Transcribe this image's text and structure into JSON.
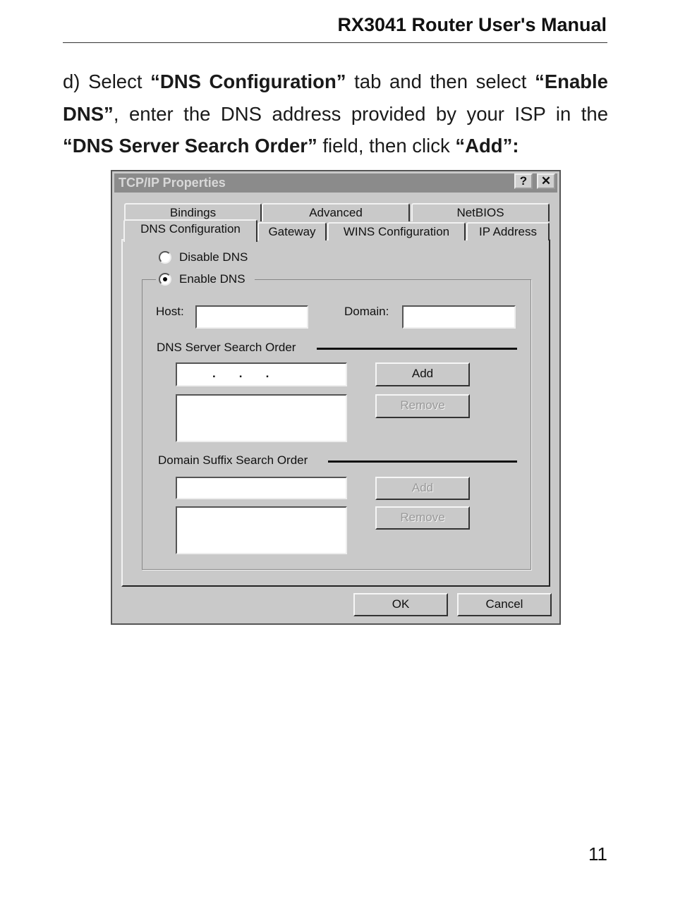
{
  "header": {
    "title": "RX3041 Router User's Manual"
  },
  "instructions": {
    "step": "d) Select ",
    "tab_name": "“DNS Configuration”",
    "mid1": " tab and then select ",
    "enable": "“Enable DNS”",
    "mid2": ", enter the DNS address provided by your ISP in the ",
    "field": "“DNS Server Search Order”",
    "mid3": " field, then click ",
    "add": "“Add”:"
  },
  "dialog": {
    "title": "TCP/IP Properties",
    "help": "?",
    "close": "✕",
    "tabs_row1": [
      "Bindings",
      "Advanced",
      "NetBIOS"
    ],
    "tabs_row2": [
      "DNS Configuration",
      "Gateway",
      "WINS Configuration",
      "IP Address"
    ],
    "disable_dns": "Disable DNS",
    "enable_dns": "Enable DNS",
    "enable_selected": true,
    "host_label": "Host:",
    "host_value": "",
    "domain_label": "Domain:",
    "domain_value": "",
    "dns_order_label": "DNS Server Search Order",
    "dns_ip": ".       .       .",
    "add": "Add",
    "remove": "Remove",
    "suffix_label": "Domain Suffix Search Order",
    "ok": "OK",
    "cancel": "Cancel"
  },
  "page_number": "11"
}
